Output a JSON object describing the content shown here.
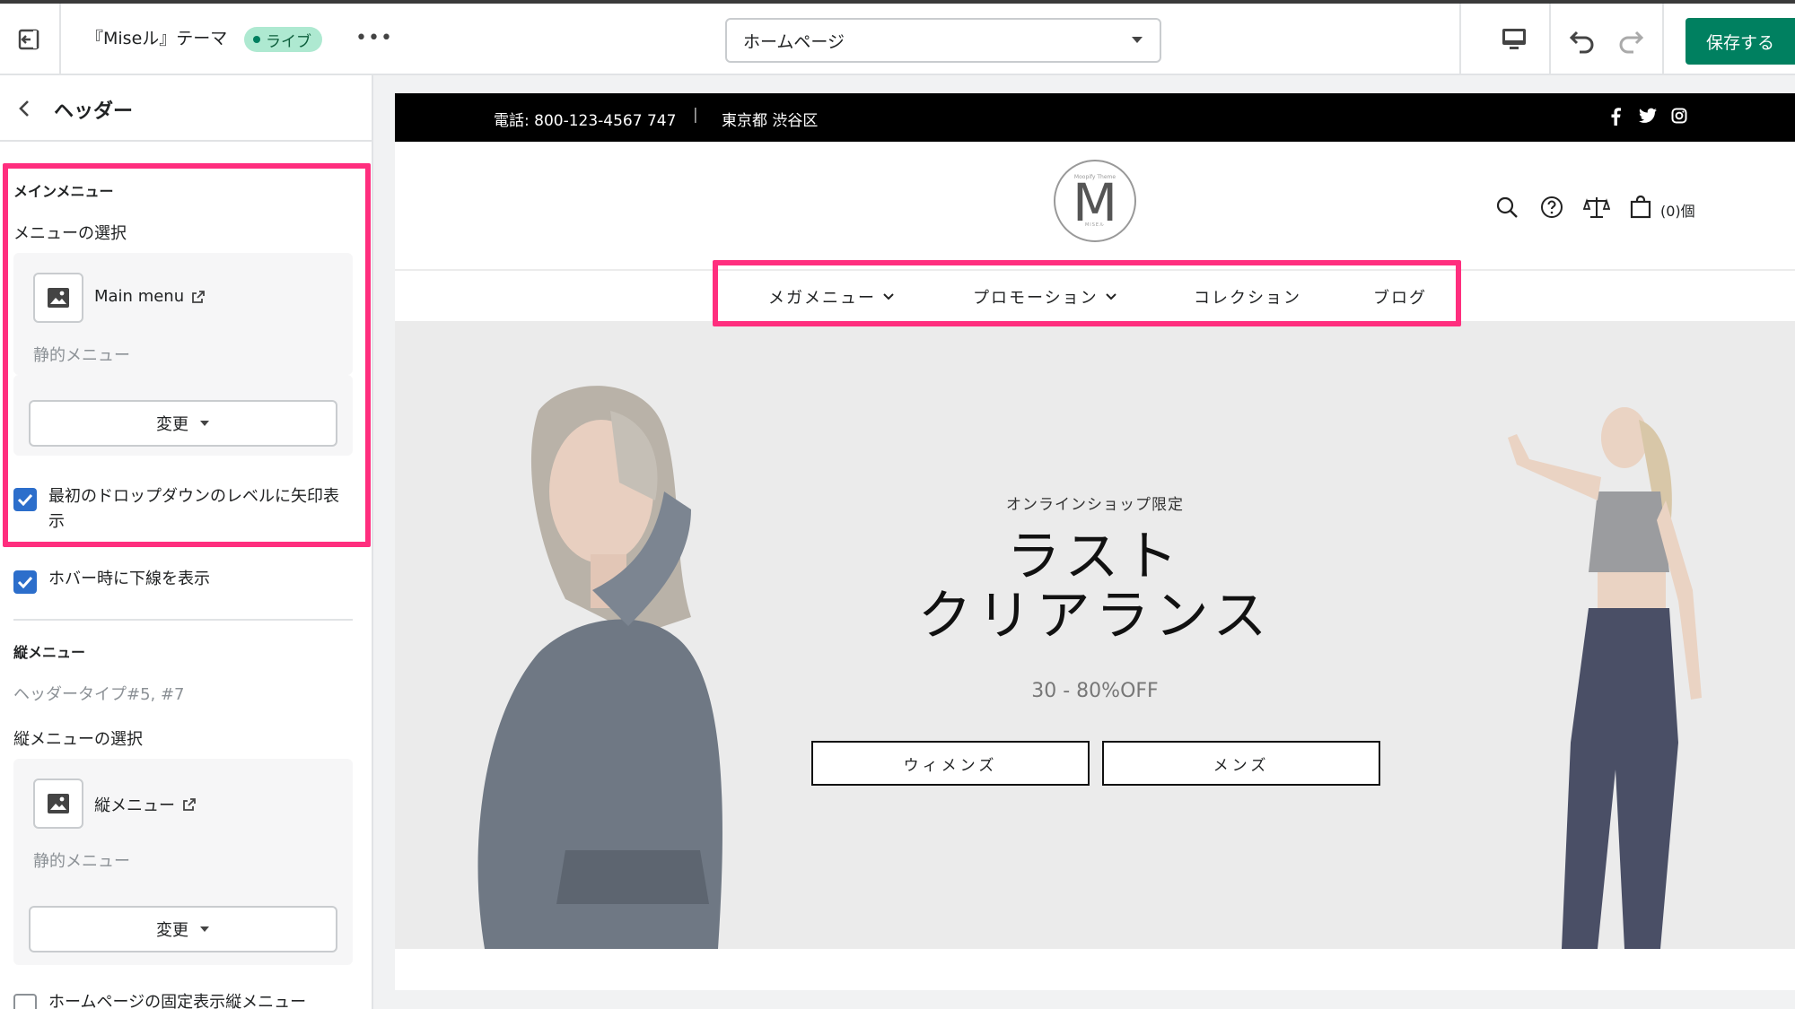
{
  "topbar": {
    "theme_title": "『Miseル』テーマ",
    "live_badge": "ライブ",
    "more": "•••",
    "page_select": "ホームページ",
    "save_label": "保存する"
  },
  "sidebar": {
    "title": "ヘッダー",
    "main_menu": {
      "section_title": "メインメニュー",
      "select_label": "メニューの選択",
      "menu_name": "Main menu",
      "menu_type": "静的メニュー",
      "change_label": "変更"
    },
    "checkboxes": [
      {
        "label": "最初のドロップダウンのレベルに矢印表示",
        "checked": true
      },
      {
        "label": "ホバー時に下線を表示",
        "checked": true
      }
    ],
    "vertical_menu": {
      "section_title": "縦メニュー",
      "note": "ヘッダータイプ#5, #7",
      "select_label": "縦メニューの選択",
      "menu_name": "縦メニュー",
      "menu_type": "静的メニュー",
      "change_label": "変更"
    },
    "fixed_checkbox": {
      "label": "ホームページの固定表示縦メニュー",
      "checked": false
    }
  },
  "store": {
    "announcement": {
      "phone": "電話: 800-123-4567 747",
      "separator": "|",
      "address": "東京都 渋谷区"
    },
    "logo": {
      "letter": "M",
      "top_text": "Moopify Theme",
      "bottom_text": "MISEル"
    },
    "cart_count": "(0)個",
    "nav": [
      "メガメニュー",
      "プロモーション",
      "コレクション",
      "ブログ"
    ],
    "hero": {
      "subtitle": "オンラインショップ限定",
      "title_line1": "ラスト",
      "title_line2": "クリアランス",
      "discount": "30 - 80%OFF",
      "button_women": "ウィメンズ",
      "button_men": "メンズ"
    }
  },
  "colors": {
    "accent_save": "#008060",
    "highlight": "#ff2e7e",
    "checkbox": "#2c6ecb",
    "live_badge": "#aee9d1"
  }
}
